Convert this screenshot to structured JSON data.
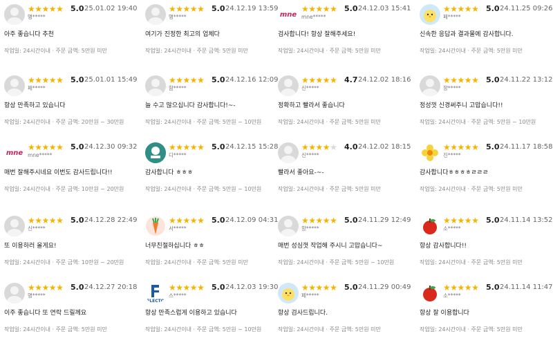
{
  "reviews": [
    {
      "avatar": "default-avatar-icon",
      "rating": 5,
      "score": "5.0",
      "date": "25.01.02 19:40",
      "user": "명*****",
      "text": "아주 좋습니다 추천",
      "meta": "작업일: 24시간이내 · 주문 금액: 5만원 미만"
    },
    {
      "avatar": "default-avatar-icon",
      "rating": 5,
      "score": "5.0",
      "date": "25.01.01 15:49",
      "user": "페*****",
      "text": "항상 만족하고 있습니다",
      "meta": "작업일: 24시간이내 · 주문 금액: 20만원 ~ 30만원"
    },
    {
      "avatar": "mne-logo-icon",
      "logo_text": "mne",
      "rating": 5,
      "score": "5.0",
      "date": "24.12.30 09:32",
      "user": "mne*****",
      "text": "매번 잘해주시네요 이번도 감사드립니다!!",
      "meta": "작업일: 24시간이내 · 주문 금액: 10만원 ~ 20만원"
    },
    {
      "avatar": "default-avatar-icon",
      "rating": 5,
      "score": "5.0",
      "date": "24.12.28 22:49",
      "user": "신*****",
      "text": "또 이용하러 올게요!",
      "meta": "작업일: 24시간이내 · 주문 금액: 10만원 ~ 20만원"
    },
    {
      "avatar": "default-avatar-icon",
      "rating": 5,
      "score": "5.0",
      "date": "24.12.27 20:18",
      "user": "명*****",
      "text": "이주 좋습니다 또 연락 드릴께요",
      "meta": "작업일: 24시간이내 · 주문 금액: 5만원 미만"
    },
    {
      "avatar": "default-avatar-icon",
      "rating": 5,
      "score": "5.0",
      "date": "24.12.19 13:59",
      "user": "명*****",
      "text": "여기가 진정한 최고의 업체다",
      "meta": "작업일: 24시간이내 · 주문 금액: 5만원 미만"
    },
    {
      "avatar": "default-avatar-icon",
      "rating": 5,
      "score": "5.0",
      "date": "24.12.16 12:09",
      "user": "함*****",
      "text": "늘 수고 많으십니다 감사합니다!~-",
      "meta": "작업일: 24시간이내 · 주문 금액: 5만원 ~ 10만원"
    },
    {
      "avatar": "mint-logo-icon",
      "logo_text": "",
      "rating": 5,
      "score": "5.0",
      "date": "24.12.15 15:28",
      "user": "디*****",
      "text": "감사합니다 ㅎㅎㅎ",
      "meta": "작업일: 24시간이내 · 주문 금액: 5만원 ~ 10만원"
    },
    {
      "avatar": "carrot-icon",
      "rating": 5,
      "score": "5.0",
      "date": "24.12.09 04:31",
      "user": "서*****",
      "text": "너무친절하십니다 ㅎㅎ",
      "meta": "작업일: 24시간이내 · 주문 금액: 5만원 미만"
    },
    {
      "avatar": "flecto-logo-icon",
      "logo_text": "FLECTO",
      "rating": 5,
      "score": "5.0",
      "date": "24.12.03 19:30",
      "user": "스*****",
      "text": "항상 만족스럽게 이용하고 있습니다",
      "meta": "작업일: 24시간이내 · 주문 금액: 5만원 ~ 10만원"
    },
    {
      "avatar": "mne-logo-icon",
      "logo_text": "mne",
      "rating": 5,
      "score": "5.0",
      "date": "24.12.03 15:41",
      "user": "mne*****",
      "text": "검사합니다! 항상 잘해주세요!",
      "meta": "작업일: 24시간이내 · 주문 금액: 5만원 미만"
    },
    {
      "avatar": "default-avatar-icon",
      "rating": 4.5,
      "score": "4.7",
      "date": "24.12.02 18:16",
      "user": "신*****",
      "text": "정확하고 빨라서 좋습니다",
      "meta": "작업일: 24시간이내 · 주문 금액: 5만원 미만"
    },
    {
      "avatar": "default-avatar-icon",
      "rating": 4,
      "score": "4.0",
      "date": "24.12.02 18:15",
      "user": "신*****",
      "text": "빨라서 좋아요-~-",
      "meta": "작업일: 24시간이내 · 주문 금액: 5만원 미만"
    },
    {
      "avatar": "default-avatar-icon",
      "rating": 5,
      "score": "5.0",
      "date": "24.11.29 12:49",
      "user": "항*****",
      "text": "매번 성심껏 작업해 주시니 고맙습니다~",
      "meta": "작업일: 24시간이내 · 주문 금액: 5만원 ~ 10만원"
    },
    {
      "avatar": "chick-icon",
      "rating": 5,
      "score": "5.0",
      "date": "24.11.29 00:49",
      "user": "페*****",
      "text": "항상 검사드립니다.",
      "meta": "작업일: 24시간이내 · 주문 금액: 5만원 미만"
    },
    {
      "avatar": "chick-icon",
      "rating": 5,
      "score": "5.0",
      "date": "24.11.25 09:26",
      "user": "페*****",
      "text": "신속한 응답과 결과물에 감사합니다.",
      "meta": "작업일: 24시간이내 · 주문 금액: 5만원 미만"
    },
    {
      "avatar": "default-avatar-icon",
      "rating": 5,
      "score": "5.0",
      "date": "24.11.22 13:12",
      "user": "항*****",
      "text": "정성껏 신경써주니 고맙습니다!!",
      "meta": "작업일: 24시간이내 · 주문 금액: 5만원 ~ 10만원"
    },
    {
      "avatar": "flower-icon",
      "rating": 5,
      "score": "5.0",
      "date": "24.11.17 18:58",
      "user": "진*****",
      "text": "감사합니다ㅎㅎㅎㅎㄹㄹㄹ",
      "meta": "작업일: 24시간이내 · 주문 금액: 5만원 미만"
    },
    {
      "avatar": "apple-icon",
      "rating": 5,
      "score": "5.0",
      "date": "24.11.14 13:52",
      "user": "소*****",
      "text": "항상 감사합니다!!",
      "meta": "작업일: 24시간이내 · 주문 금액: 5만원 미만"
    },
    {
      "avatar": "apple-icon",
      "rating": 5,
      "score": "5.0",
      "date": "24.11.14 11:47",
      "user": "소*****",
      "text": "항상 잘 이용합니다",
      "meta": "작업일: 24시간이내 · 주문 금액: 5만원 미만"
    }
  ]
}
